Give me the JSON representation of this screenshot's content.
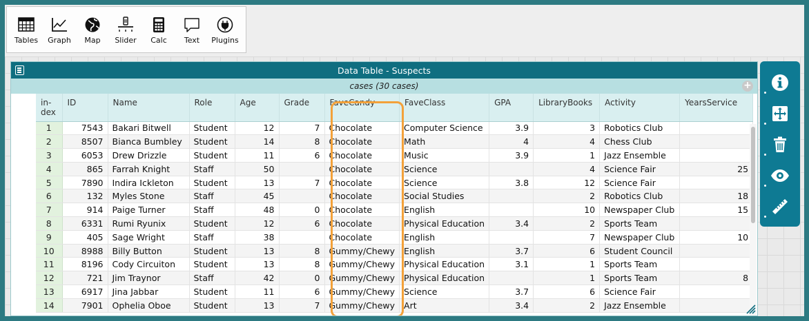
{
  "toolbar": {
    "tables": "Tables",
    "graph": "Graph",
    "map": "Map",
    "slider": "Slider",
    "calc": "Calc",
    "text": "Text",
    "plugins": "Plugins"
  },
  "table": {
    "title": "Data Table - Suspects",
    "collection": "cases (30 cases)",
    "add_icon": "plus-circle-icon",
    "columns": [
      "in-\ndex",
      "ID",
      "Name",
      "Role",
      "Age",
      "Grade",
      "FaveCandy",
      "FaveClass",
      "GPA",
      "LibraryBooks",
      "Activity",
      "YearsService"
    ],
    "rows": [
      [
        "1",
        "7543",
        "Bakari Bitwell",
        "Student",
        "12",
        "7",
        "Chocolate",
        "Computer Science",
        "3.9",
        "3",
        "Robotics Club",
        ""
      ],
      [
        "2",
        "8507",
        "Bianca Bumbley",
        "Student",
        "14",
        "8",
        "Chocolate",
        "Math",
        "4",
        "4",
        "Chess Club",
        ""
      ],
      [
        "3",
        "6053",
        "Drew Drizzle",
        "Student",
        "11",
        "6",
        "Chocolate",
        "Music",
        "3.9",
        "1",
        "Jazz Ensemble",
        ""
      ],
      [
        "4",
        "865",
        "Farrah Knight",
        "Staff",
        "50",
        "",
        "Chocolate",
        "Science",
        "",
        "4",
        "Science Fair",
        "25"
      ],
      [
        "5",
        "7890",
        "Indira Ickleton",
        "Student",
        "13",
        "7",
        "Chocolate",
        "Science",
        "3.8",
        "12",
        "Science Fair",
        ""
      ],
      [
        "6",
        "132",
        "Myles Stone",
        "Staff",
        "45",
        "",
        "Chocolate",
        "Social Studies",
        "",
        "2",
        "Robotics Club",
        "18"
      ],
      [
        "7",
        "914",
        "Paige Turner",
        "Staff",
        "48",
        "0",
        "Chocolate",
        "English",
        "",
        "10",
        "Newspaper Club",
        "15"
      ],
      [
        "8",
        "6331",
        "Rumi Ryunix",
        "Student",
        "12",
        "6",
        "Chocolate",
        "Physical Education",
        "3.4",
        "2",
        "Sports Team",
        ""
      ],
      [
        "9",
        "405",
        "Sage Wright",
        "Staff",
        "38",
        "",
        "Chocolate",
        "English",
        "",
        "7",
        "Newspaper Club",
        "10"
      ],
      [
        "10",
        "8988",
        "Billy Button",
        "Student",
        "13",
        "8",
        "Gummy/Chewy",
        "English",
        "3.7",
        "6",
        "Student Council",
        ""
      ],
      [
        "11",
        "8196",
        "Cody Circuiton",
        "Student",
        "13",
        "8",
        "Gummy/Chewy",
        "Physical Education",
        "3.1",
        "1",
        "Sports Team",
        ""
      ],
      [
        "12",
        "721",
        "Jim Traynor",
        "Staff",
        "42",
        "0",
        "Gummy/Chewy",
        "Physical Education",
        "",
        "1",
        "Sports Team",
        "8"
      ],
      [
        "13",
        "6917",
        "Jina Jabbar",
        "Student",
        "11",
        "6",
        "Gummy/Chewy",
        "Science",
        "3.7",
        "6",
        "Science Fair",
        ""
      ],
      [
        "14",
        "7901",
        "Ophelia Oboe",
        "Student",
        "13",
        "7",
        "Gummy/Chewy",
        "Art",
        "3.4",
        "2",
        "Jazz Ensemble",
        ""
      ]
    ]
  },
  "inspector": [
    "info-icon",
    "scale-icon",
    "trash-icon",
    "eye-icon",
    "ruler-icon"
  ],
  "colors": {
    "background": "#2d7a82",
    "title_bar": "#0f6e80",
    "highlight": "#f3a13a",
    "inspector": "#0e7a93"
  }
}
